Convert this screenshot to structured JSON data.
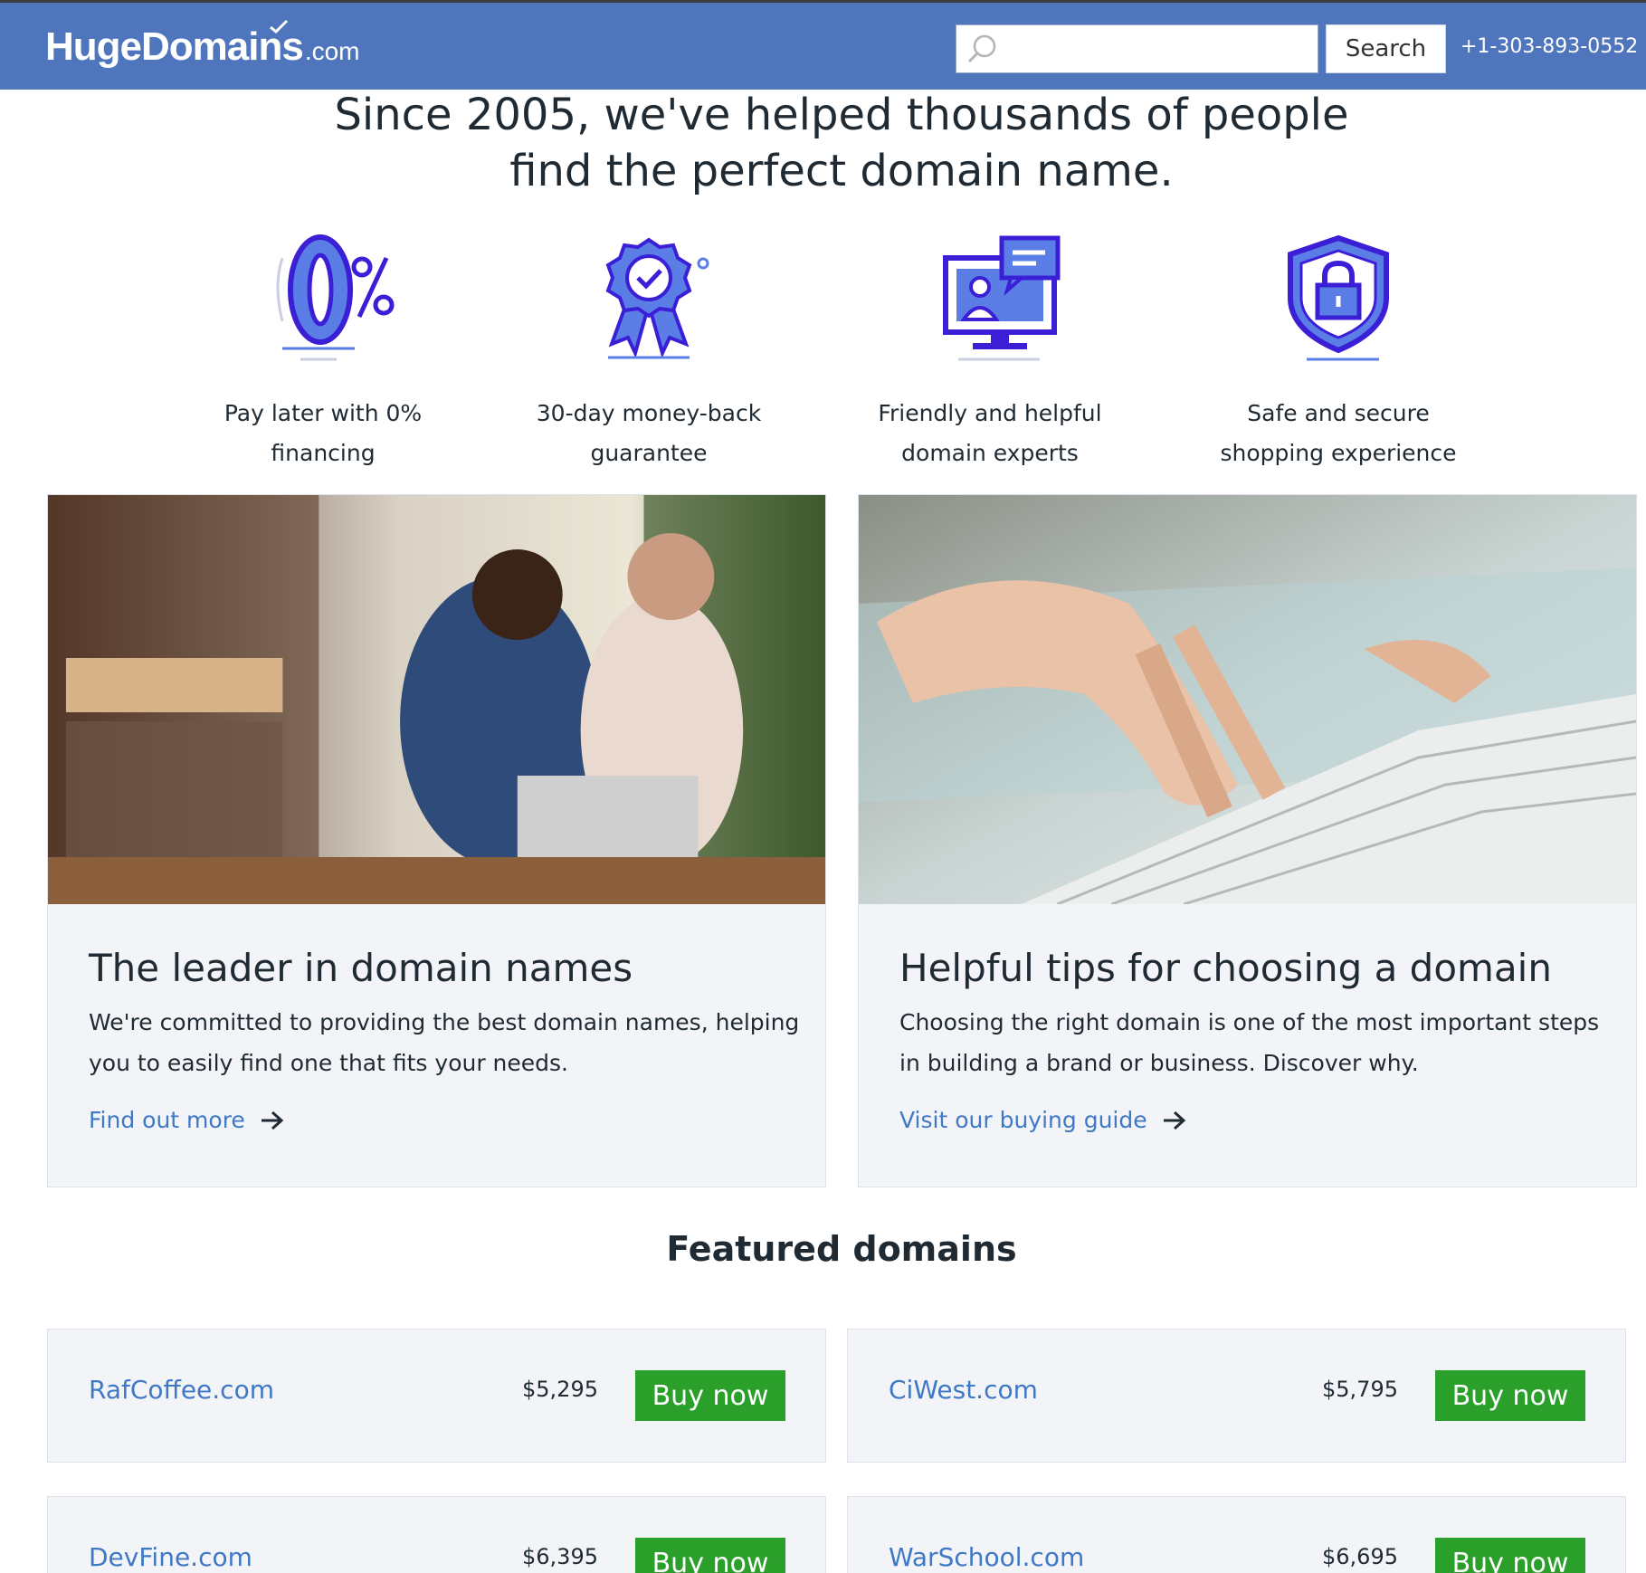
{
  "header": {
    "logo_brand": "HugeDomains",
    "logo_tld": ".com",
    "search_value": "",
    "search_button": "Search",
    "phone": "+1-303-893-0552",
    "colors": {
      "bar": "#4f75bc",
      "accent_link": "#3f79c6",
      "buy_button": "#2aa02a"
    }
  },
  "hero": {
    "line1": "Since 2005, we've helped thousands of people",
    "line2": "find the perfect domain name."
  },
  "features": [
    {
      "icon": "zero-percent-icon",
      "line1": "Pay later with 0%",
      "line2": "financing"
    },
    {
      "icon": "ribbon-badge-icon",
      "line1": "30-day money-back",
      "line2": "guarantee"
    },
    {
      "icon": "chat-monitor-icon",
      "line1": "Friendly and helpful",
      "line2": "domain experts"
    },
    {
      "icon": "lock-shield-icon",
      "line1": "Safe and secure",
      "line2": "shopping experience"
    }
  ],
  "cards": [
    {
      "title": "The leader in domain names",
      "desc_line1": "We're committed to providing the best domain names, helping",
      "desc_line2": "you to easily find one that fits your needs.",
      "link": "Find out more"
    },
    {
      "title": "Helpful tips for choosing a domain",
      "desc_line1": "Choosing the right domain is one of the most important steps",
      "desc_line2": "in building a brand or business. Discover why.",
      "link": "Visit our buying guide"
    }
  ],
  "featured": {
    "title": "Featured domains",
    "buy_label": "Buy now",
    "domains": [
      {
        "name": "RafCoffee.com",
        "price": "$5,295"
      },
      {
        "name": "CiWest.com",
        "price": "$5,795"
      },
      {
        "name": "DevFine.com",
        "price": "$6,395"
      },
      {
        "name": "WarSchool.com",
        "price": "$6,695"
      }
    ]
  }
}
